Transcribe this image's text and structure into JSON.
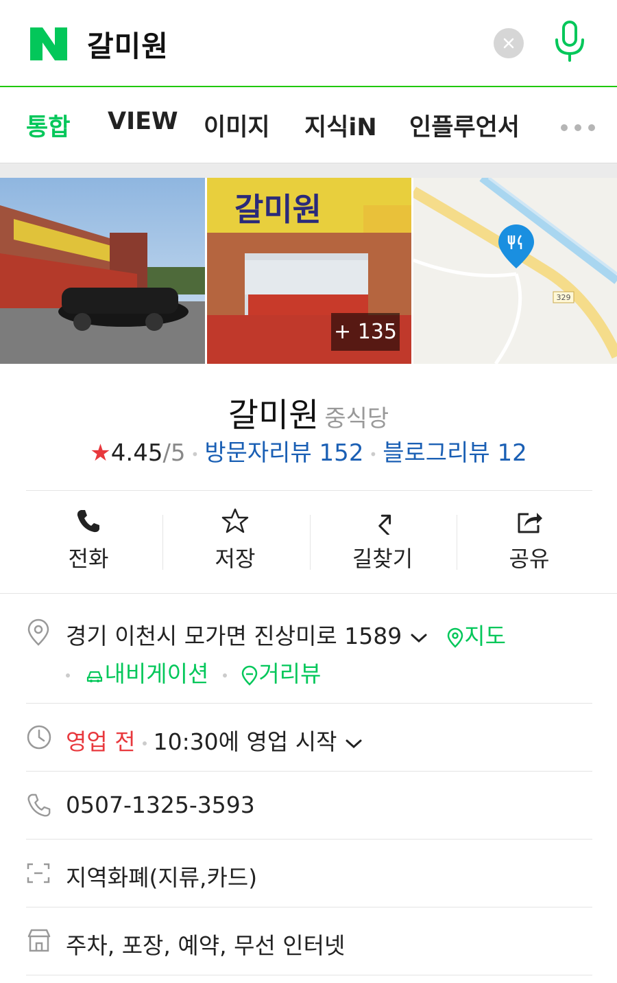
{
  "search": {
    "query": "갈미원",
    "logo_letter": "N"
  },
  "tabs": [
    {
      "label": "통합",
      "active": true
    },
    {
      "label": "VIEW",
      "active": false
    },
    {
      "label": "이미지",
      "active": false
    },
    {
      "label": "지식iN",
      "active": false
    },
    {
      "label": "인플루언서",
      "active": false
    }
  ],
  "photos": {
    "more_count": "+ 135",
    "map_road_label": "329"
  },
  "place": {
    "name": "갈미원",
    "category": "중식당",
    "rating": "4.45",
    "rating_max": "/5",
    "visitor_reviews": "방문자리뷰 152",
    "blog_reviews": "블로그리뷰 12"
  },
  "actions": [
    {
      "label": "전화",
      "icon": "phone-icon"
    },
    {
      "label": "저장",
      "icon": "star-icon"
    },
    {
      "label": "길찾기",
      "icon": "directions-icon"
    },
    {
      "label": "공유",
      "icon": "share-icon"
    }
  ],
  "info": {
    "address": "경기 이천시 모가면 진상미로 1589",
    "map_link": "지도",
    "navigation_link": "내비게이션",
    "streetview_link": "거리뷰",
    "status": "영업 전",
    "hours": "10:30에 영업 시작",
    "phone": "0507-1325-3593",
    "payment": "지역화폐(지류,카드)",
    "amenities": "주차, 포장, 예약, 무선 인터넷"
  },
  "colors": {
    "naver_green": "#03c75a",
    "link_blue": "#1a5fb4",
    "star_red": "#e8383d"
  }
}
